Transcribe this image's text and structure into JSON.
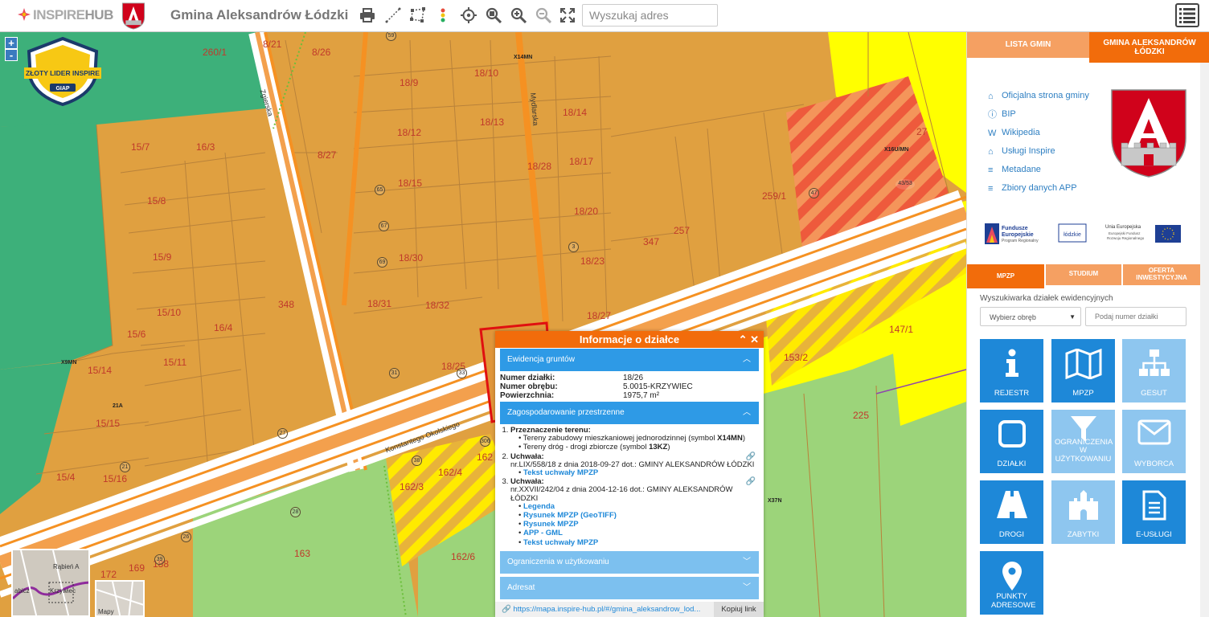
{
  "header": {
    "logo_text_a": "INSPIRE",
    "logo_text_b": "HUB",
    "title": "Gmina Aleksandrów Łódzki",
    "search_placeholder": "Wyszukaj adres"
  },
  "map": {
    "zoom_in": "+",
    "zoom_out": "-",
    "badge": {
      "line1": "ZŁOTY LIDER INSPIRE",
      "line2": "GIAP"
    },
    "plots": [
      "260/1",
      "8/21",
      "8/26",
      "18/9",
      "18/10",
      "18/12",
      "18/13",
      "18/14",
      "18/28",
      "18/17",
      "15/7",
      "16/3",
      "8/27",
      "18/15",
      "15/8",
      "18/20",
      "347",
      "257",
      "259/1",
      "27",
      "15/9",
      "18/30",
      "18/23",
      "348",
      "15/10",
      "16/4",
      "18/31",
      "18/32",
      "18/27",
      "15/6",
      "147/1",
      "15/14",
      "15/11",
      "18/25",
      "153/2",
      "15/15",
      "225",
      "15/4",
      "15/16",
      "162/3",
      "162/4",
      "162",
      "163",
      "162/6",
      "172",
      "169",
      "188"
    ],
    "symbols": [
      "X14MN",
      "X16U/MN",
      "X9MN",
      "X37N",
      "21A"
    ],
    "addresses": [
      "59",
      "65",
      "67",
      "69",
      "3",
      "47",
      "43/53",
      "33",
      "31",
      "27",
      "21",
      "28",
      "26",
      "38",
      "39",
      "306"
    ],
    "streets": [
      "Zgierska",
      "Mydlarska",
      "Konstantego Okolskiego"
    ],
    "minimap": {
      "label1": "Rąbień A",
      "label2": "Krzywiec",
      "label3": "abicz",
      "label4": "Mapy"
    }
  },
  "popup": {
    "title": "Informacje o działce",
    "sections": {
      "ewidencja": "Ewidencja gruntów",
      "zagospodarowanie": "Zagospodarowanie przestrzenne",
      "ograniczenia": "Ograniczenia w użytkowaniu",
      "adresat": "Adresat"
    },
    "fields": [
      {
        "k": "Numer działki:",
        "v": "18/26"
      },
      {
        "k": "Numer obrębu:",
        "v": "5.0015-KRZYWIEC"
      },
      {
        "k": "Powierzchnia:",
        "v": "1975,7 m²"
      }
    ],
    "plan": {
      "przeznaczenie_label": "Przeznaczenie terenu:",
      "p1_a": "Tereny zabudowy mieszkaniowej jednorodzinnej (symbol ",
      "p1_b": "X14MN",
      "p1_c": ")",
      "p2_a": "Tereny dróg - drogi zbiorcze (symbol ",
      "p2_b": "13KZ",
      "p2_c": ")",
      "uchwala_label": "Uchwała:",
      "uchwala1": "nr.LIX/558/18 z dnia 2018-09-27 dot.: GMINY ALEKSANDRÓW ŁÓDZKI",
      "uchwala1_link": "Tekst uchwały MPZP",
      "uchwala2": "nr.XXVII/242/04 z dnia 2004-12-16 dot.: GMINY ALEKSANDRÓW ŁÓDZKI",
      "links2": [
        "Legenda",
        "Rysunek MPZP (GeoTIFF)",
        "Rysunek MPZP",
        "APP - GML",
        "Tekst uchwały MPZP"
      ]
    },
    "url": "https://mapa.inspire-hub.pl/#/gmina_aleksandrow_lod...",
    "copy_button": "Kopiuj link"
  },
  "panel": {
    "tab_lista": "LISTA GMIN",
    "tab_gmina": "GMINA ALEKSANDRÓW ŁÓDZKI",
    "links": [
      "Oficjalna strona gminy",
      "BIP",
      "Wikipedia",
      "Usługi Inspire",
      "Metadane",
      "Zbiory danych APP"
    ],
    "eu": {
      "fe1": "Fundusze",
      "fe2": "Europejskie",
      "fe3": "Program Regionalny",
      "lodz": "łódzkie",
      "ue1": "Unia Europejska",
      "ue2": "Europejski Fundusz",
      "ue3": "Rozwoju Regionalnego"
    },
    "mode_tabs": [
      "MPZP",
      "STUDIUM",
      "OFERTA INWESTYCYJNA"
    ],
    "search_label": "Wyszukiwarka działek ewidencyjnych",
    "obreb_placeholder": "Wybierz obręb",
    "dzialka_placeholder": "Podaj numer działki",
    "tiles": [
      "REJESTR",
      "MPZP",
      "GESUT",
      "DZIAŁKI",
      "OGRANICZENIA W UŻYTKOWANIU",
      "WYBORCA",
      "DROGI",
      "ZABYTKI",
      "E-USŁUGI",
      "PUNKTY ADRESOWE"
    ]
  },
  "colors": {
    "accent_orange": "#f26c0b",
    "tile_blue": "#1e88d8",
    "tile_light": "#8ec6ef",
    "parcel_orange": "#e0a040",
    "zone_green": "#3db07a",
    "zone_yellow": "#ffff00"
  }
}
